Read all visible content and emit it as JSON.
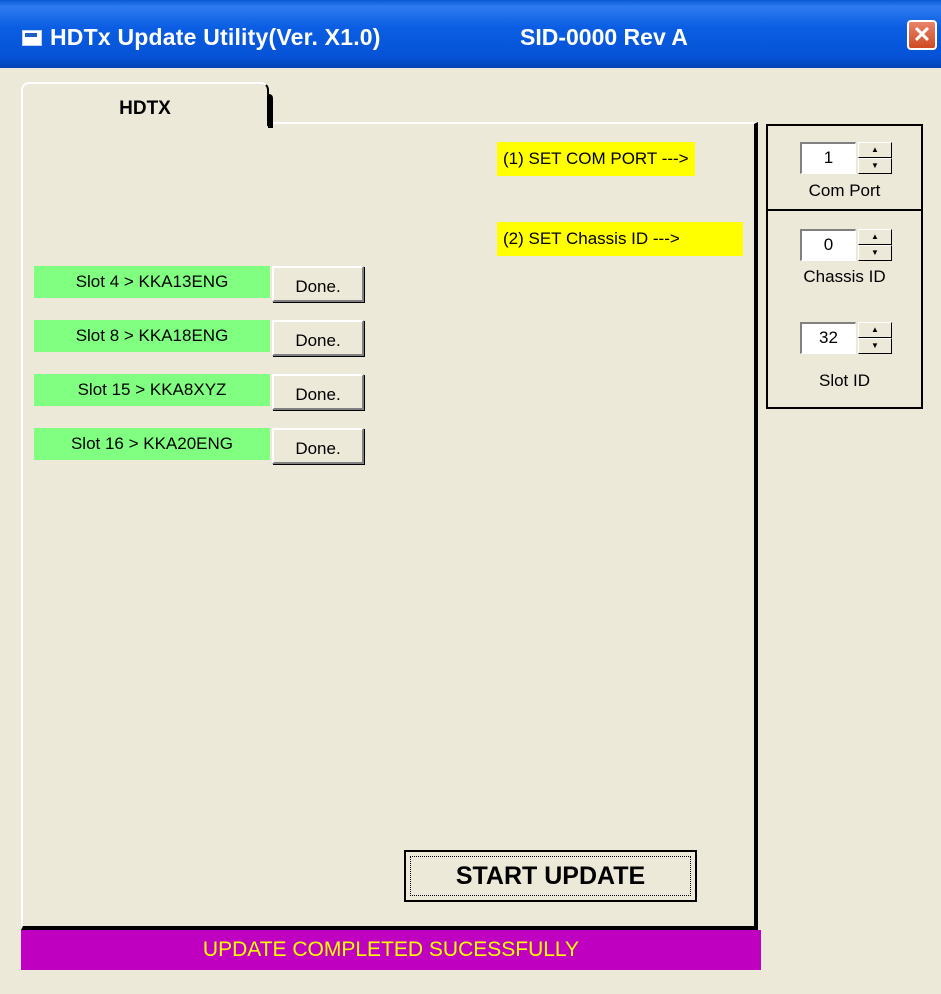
{
  "window": {
    "title": "HDTx Update Utility(Ver. X1.0)",
    "sid": "SID-0000 Rev A",
    "close_symbol": "✕"
  },
  "tab": {
    "label": "HDTX"
  },
  "steps": {
    "com_port_prompt": "(1)  SET COM PORT --->",
    "chassis_prompt": "(2)  SET Chassis ID --->"
  },
  "slots": [
    {
      "label": "Slot 4 > KKA13ENG",
      "status": "Done."
    },
    {
      "label": "Slot 8 > KKA18ENG",
      "status": "Done."
    },
    {
      "label": "Slot 15 > KKA8XYZ",
      "status": "Done."
    },
    {
      "label": "Slot 16 > KKA20ENG",
      "status": "Done."
    }
  ],
  "start_button": {
    "label": "START UPDATE"
  },
  "status_bar": {
    "text": "UPDATE COMPLETED SUCESSFULLY"
  },
  "settings": {
    "com_port": {
      "value": "1",
      "label": "Com Port"
    },
    "chassis_id": {
      "value": "0",
      "label": "Chassis ID"
    },
    "slot_id": {
      "value": "32",
      "label": "Slot ID"
    }
  },
  "spin_glyphs": {
    "up": "▲",
    "down": "▼"
  },
  "colors": {
    "title_bar": "#0b5ee3",
    "prompt": "#ffff00",
    "slot_done": "#80ff80",
    "status_bg": "#c000c0",
    "status_text": "#ffff00"
  },
  "icons": [
    "app-icon",
    "close-icon",
    "spin-up-icon",
    "spin-down-icon"
  ]
}
